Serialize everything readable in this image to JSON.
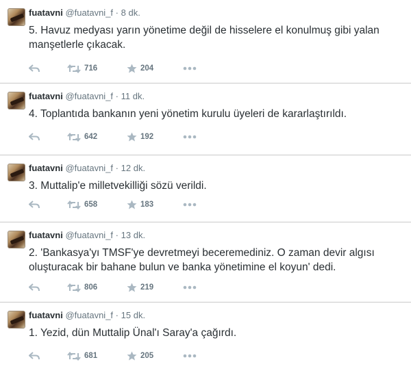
{
  "tweets": [
    {
      "name": "fuatavni",
      "handle": "@fuatavni_f",
      "dot": "·",
      "time": "8 dk.",
      "text": "5. Havuz medyası yarın yönetime değil de hisselere el konulmuş gibi yalan manşetlerle çıkacak.",
      "retweets": "716",
      "favorites": "204"
    },
    {
      "name": "fuatavni",
      "handle": "@fuatavni_f",
      "dot": "·",
      "time": "11 dk.",
      "text": "4. Toplantıda bankanın yeni yönetim kurulu üyeleri de kararlaştırıldı.",
      "retweets": "642",
      "favorites": "192"
    },
    {
      "name": "fuatavni",
      "handle": "@fuatavni_f",
      "dot": "·",
      "time": "12 dk.",
      "text": "3. Muttalip'e milletvekilliği sözü verildi.",
      "retweets": "658",
      "favorites": "183"
    },
    {
      "name": "fuatavni",
      "handle": "@fuatavni_f",
      "dot": "·",
      "time": "13 dk.",
      "text": "2. 'Bankasya'yı TMSF'ye devretmeyi beceremediniz. O zaman devir algısı oluşturacak bir bahane bulun ve banka yönetimine el koyun' dedi.",
      "retweets": "806",
      "favorites": "219"
    },
    {
      "name": "fuatavni",
      "handle": "@fuatavni_f",
      "dot": "·",
      "time": "15 dk.",
      "text": "1. Yezid, dün Muttalip Ünal'ı Saray'a çağırdı.",
      "retweets": "681",
      "favorites": "205"
    }
  ],
  "icons": {
    "reply": "reply-icon",
    "retweet": "retweet-icon",
    "favorite": "star-icon",
    "more": "more-dots-icon"
  },
  "colors": {
    "text": "#292f33",
    "meta": "#66757f",
    "icon": "#aab8c2",
    "divider": "#c9c9c9"
  }
}
